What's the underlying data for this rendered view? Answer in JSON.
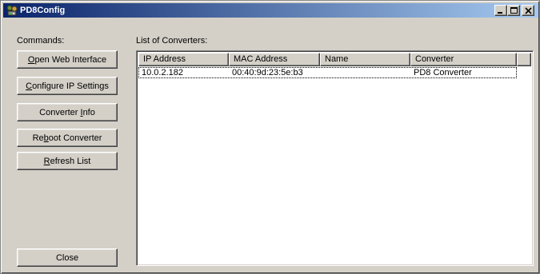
{
  "window": {
    "title": "PD8Config"
  },
  "commands": {
    "label": "Commands:",
    "open_web": {
      "pre": "",
      "key": "O",
      "post": "pen Web Interface"
    },
    "configure_ip": {
      "pre": "",
      "key": "C",
      "post": "onfigure IP Settings"
    },
    "converter_info": {
      "pre": "Converter ",
      "key": "I",
      "post": "nfo"
    },
    "reboot": {
      "pre": "Re",
      "key": "b",
      "post": "oot Converter"
    },
    "refresh": {
      "pre": "",
      "key": "R",
      "post": "efresh List"
    },
    "close": "Close"
  },
  "converters": {
    "label": "List of Converters:",
    "columns": [
      "IP Address",
      "MAC Address",
      "Name",
      "Converter",
      ""
    ],
    "rows": [
      {
        "ip": "10.0.2.182",
        "mac": "00:40:9d:23:5e:b3",
        "name": "",
        "converter": "PD8 Converter"
      }
    ]
  }
}
